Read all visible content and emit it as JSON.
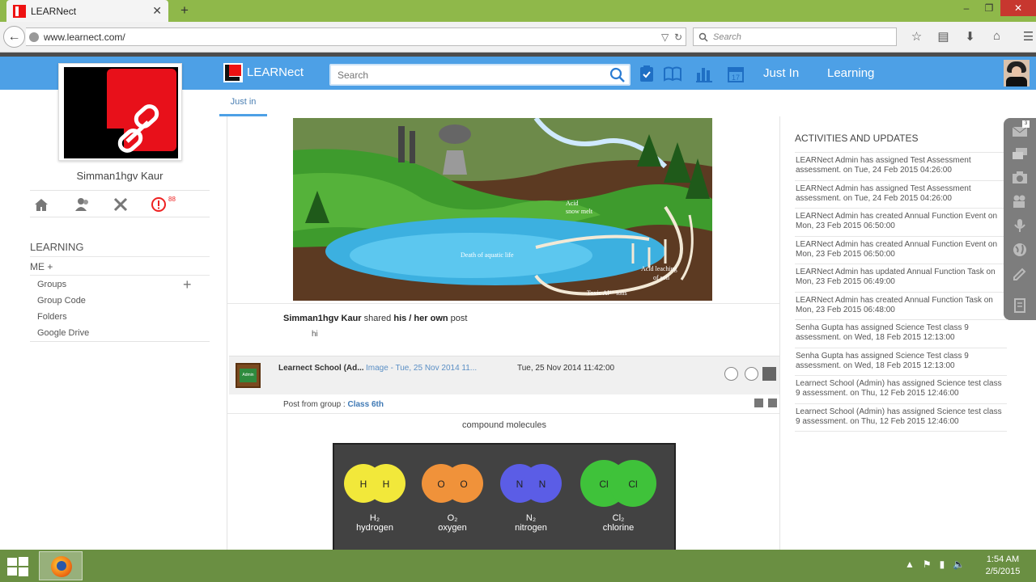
{
  "browser": {
    "tab_title": "LEARNect",
    "tab_close": "✕",
    "new_tab": "+",
    "url": "www.learnect.com/",
    "search_placeholder": "Search"
  },
  "app": {
    "name": "LEARNect",
    "search_placeholder": "Search",
    "nav_links": [
      "Just In",
      "Learning"
    ],
    "accent_color": "#4da0e6"
  },
  "sidebar": {
    "user_name": "Simman1hgv Kaur",
    "notification_count": "88",
    "learning_heading": "LEARNING",
    "me_heading": "ME +",
    "items": [
      "Groups",
      "Group Code",
      "Folders",
      "Google Drive"
    ],
    "groups_add": "+"
  },
  "feed": {
    "active_tab": "Just in",
    "post1": {
      "author": "Simman1hgv Kaur",
      "shared_text": "shared",
      "owner_text": "his / her own",
      "post_word": "post",
      "body": "hi",
      "image_labels": {
        "acid_snow": "Acid\nsnow melt",
        "death": "Death of aquatic life",
        "acid_leaching": "Acid leaching\nof soil",
        "toxic": "Toxic Al³⁺ ions"
      }
    },
    "post2": {
      "school": "Learnect School (Ad...",
      "image_link": "Image - Tue, 25 Nov 2014 11...",
      "date": "Tue, 25 Nov 2014 11:42:00",
      "group_prefix": "Post from group :",
      "group_name": "Class 6th",
      "caption": "compound molecules",
      "avatar_text": "Admin",
      "molecules": [
        {
          "atoms": [
            "H",
            "H"
          ],
          "formula": "H₂",
          "name": "hydrogen",
          "color": "#f2e83a"
        },
        {
          "atoms": [
            "O",
            "O"
          ],
          "formula": "O₂",
          "name": "oxygen",
          "color": "#f0923a"
        },
        {
          "atoms": [
            "N",
            "N"
          ],
          "formula": "N₂",
          "name": "nitrogen",
          "color": "#5b5de6"
        },
        {
          "atoms": [
            "Cl",
            "Cl"
          ],
          "formula": "Cl₂",
          "name": "chlorine",
          "color": "#3fc23a"
        }
      ]
    }
  },
  "activities": {
    "heading": "ACTIVITIES AND UPDATES",
    "items": [
      "LEARNect Admin has assigned Test Assessment assessment. on Tue, 24 Feb 2015 04:26:00",
      "LEARNect Admin has assigned Test Assessment assessment. on Tue, 24 Feb 2015 04:26:00",
      "LEARNect Admin has created Annual Function Event on Mon, 23 Feb 2015 06:50:00",
      "LEARNect Admin has created Annual Function Event on Mon, 23 Feb 2015 06:50:00",
      "LEARNect Admin has updated Annual Function Task on Mon, 23 Feb 2015 06:49:00",
      "LEARNect Admin has created Annual Function Task on Mon, 23 Feb 2015 06:48:00",
      "Senha Gupta has assigned Science Test class 9 assessment. on Wed, 18 Feb 2015 12:13:00",
      "Senha Gupta has assigned Science Test class 9 assessment. on Wed, 18 Feb 2015 12:13:00",
      "Learnect School (Admin) has assigned Science test class 9 assessment. on Thu, 12 Feb 2015 12:46:00",
      "Learnect School (Admin) has assigned Science test class 9 assessment. on Thu, 12 Feb 2015 12:46:00"
    ],
    "mail_badge": "3"
  },
  "taskbar": {
    "time": "1:54 AM",
    "date": "2/5/2015"
  }
}
